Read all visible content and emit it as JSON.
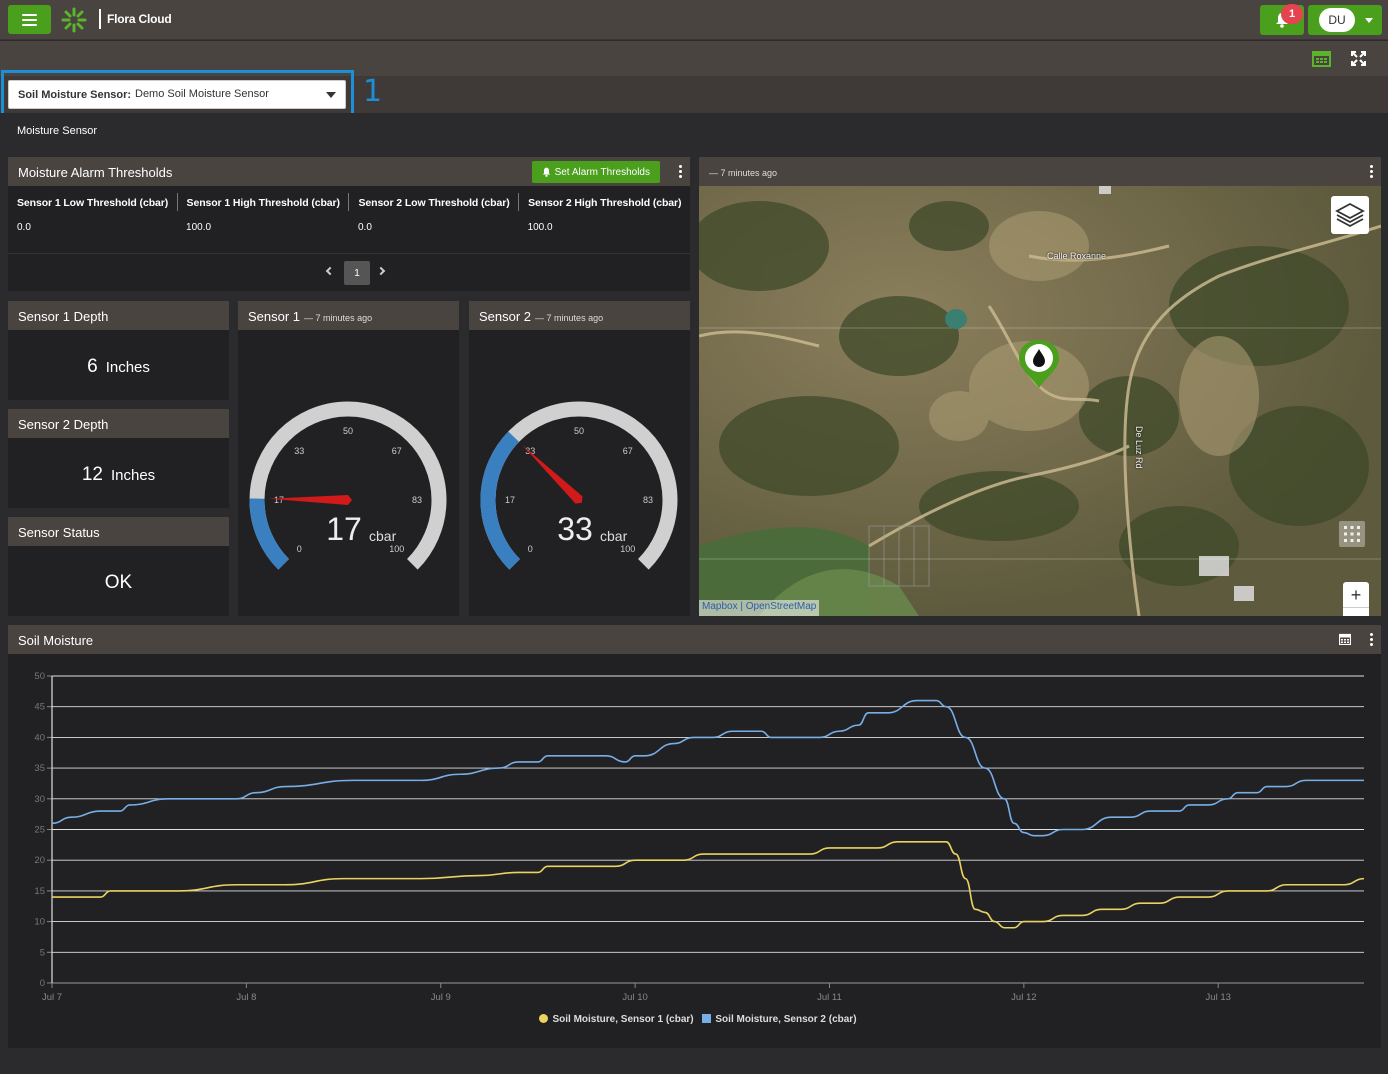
{
  "app": {
    "title": "Flora Cloud"
  },
  "header": {
    "notification_count": "1",
    "user_initials": "DU"
  },
  "selector": {
    "label": "Soil Moisture Sensor:",
    "value": "Demo Soil Moisture Sensor",
    "callout": "1"
  },
  "page": {
    "subtitle": "Moisture Sensor"
  },
  "alarm_panel": {
    "title": "Moisture Alarm Thresholds",
    "button_label": "Set Alarm Thresholds",
    "columns": [
      "Sensor 1 Low Threshold (cbar)",
      "Sensor 1 High Threshold (cbar)",
      "Sensor 2 Low Threshold (cbar)",
      "Sensor 2 High Threshold (cbar)"
    ],
    "rows": [
      [
        "0.0",
        "100.0",
        "0.0",
        "100.0"
      ]
    ],
    "page": "1"
  },
  "depth1": {
    "title": "Sensor 1 Depth",
    "value": "6",
    "unit": "Inches"
  },
  "depth2": {
    "title": "Sensor 2 Depth",
    "value": "12",
    "unit": "Inches"
  },
  "status": {
    "title": "Sensor Status",
    "value": "OK"
  },
  "gauge1": {
    "title": "Sensor 1",
    "time": "— 7 minutes ago",
    "value": 17,
    "display": "17",
    "unit": "cbar",
    "min": 0,
    "max": 100,
    "ticks": [
      "0",
      "17",
      "33",
      "50",
      "67",
      "83",
      "100"
    ]
  },
  "gauge2": {
    "title": "Sensor 2",
    "time": "— 7 minutes ago",
    "value": 33,
    "display": "33",
    "unit": "cbar",
    "min": 0,
    "max": 100,
    "ticks": [
      "0",
      "17",
      "33",
      "50",
      "67",
      "83",
      "100"
    ]
  },
  "map": {
    "time": "— 7 minutes ago",
    "label_road1": "Calle Roxanne",
    "label_road2": "De Luz Rd",
    "zoom_in": "+",
    "zoom_out": "−",
    "attribution_1": "Mapbox",
    "attribution_2": "OpenStreetMap",
    "marker_icon": "water-drop-icon"
  },
  "chart_panel": {
    "title": "Soil Moisture"
  },
  "chart_data": {
    "type": "line",
    "title": "Soil Moisture",
    "x_ticks": [
      "Jul 7",
      "Jul 8",
      "Jul 9",
      "Jul 10",
      "Jul 11",
      "Jul 12",
      "Jul 13"
    ],
    "ylim": [
      0,
      50
    ],
    "y_ticks": [
      0,
      5,
      10,
      15,
      20,
      25,
      30,
      35,
      40,
      45,
      50
    ],
    "grid": true,
    "legend": "bottom",
    "series": [
      {
        "name": "Soil Moisture, Sensor 1 (cbar)",
        "color": "#ead35f",
        "points": [
          [
            0,
            14
          ],
          [
            0.25,
            14
          ],
          [
            0.3,
            15
          ],
          [
            0.65,
            15
          ],
          [
            0.95,
            16
          ],
          [
            1.2,
            16
          ],
          [
            1.5,
            17
          ],
          [
            1.9,
            17
          ],
          [
            2.2,
            17.5
          ],
          [
            2.4,
            18
          ],
          [
            2.5,
            18
          ],
          [
            2.55,
            19
          ],
          [
            2.9,
            19
          ],
          [
            3.0,
            20
          ],
          [
            3.25,
            20
          ],
          [
            3.35,
            21
          ],
          [
            3.9,
            21
          ],
          [
            4.0,
            22
          ],
          [
            4.25,
            22
          ],
          [
            4.35,
            23
          ],
          [
            4.55,
            23
          ],
          [
            4.6,
            23
          ],
          [
            4.65,
            21
          ],
          [
            4.7,
            17
          ],
          [
            4.75,
            12
          ],
          [
            4.8,
            11.5
          ],
          [
            4.85,
            10
          ],
          [
            4.9,
            9
          ],
          [
            4.95,
            9
          ],
          [
            5.0,
            10
          ],
          [
            5.1,
            10
          ],
          [
            5.2,
            11
          ],
          [
            5.3,
            11
          ],
          [
            5.4,
            12
          ],
          [
            5.5,
            12
          ],
          [
            5.6,
            13
          ],
          [
            5.7,
            13
          ],
          [
            5.8,
            14
          ],
          [
            5.95,
            14
          ],
          [
            6.05,
            15
          ],
          [
            6.25,
            15
          ],
          [
            6.35,
            16
          ],
          [
            6.65,
            16
          ],
          [
            6.75,
            17
          ]
        ]
      },
      {
        "name": "Soil Moisture, Sensor 2 (cbar)",
        "color": "#78aee6",
        "points": [
          [
            0,
            26
          ],
          [
            0.1,
            27
          ],
          [
            0.25,
            28
          ],
          [
            0.35,
            28
          ],
          [
            0.4,
            29
          ],
          [
            0.6,
            30
          ],
          [
            0.95,
            30
          ],
          [
            1.05,
            31
          ],
          [
            1.2,
            32
          ],
          [
            1.55,
            33
          ],
          [
            1.9,
            33
          ],
          [
            2.1,
            34
          ],
          [
            2.3,
            35
          ],
          [
            2.4,
            36
          ],
          [
            2.5,
            36
          ],
          [
            2.55,
            37
          ],
          [
            2.85,
            37
          ],
          [
            2.95,
            36
          ],
          [
            3.0,
            37
          ],
          [
            3.05,
            37
          ],
          [
            3.2,
            39
          ],
          [
            3.3,
            40
          ],
          [
            3.4,
            40
          ],
          [
            3.5,
            41
          ],
          [
            3.65,
            41
          ],
          [
            3.7,
            40
          ],
          [
            3.95,
            40
          ],
          [
            4.05,
            41
          ],
          [
            4.15,
            42
          ],
          [
            4.2,
            44
          ],
          [
            4.3,
            44
          ],
          [
            4.45,
            46
          ],
          [
            4.55,
            46
          ],
          [
            4.6,
            45
          ],
          [
            4.7,
            40
          ],
          [
            4.8,
            35
          ],
          [
            4.9,
            30
          ],
          [
            4.95,
            26
          ],
          [
            5.0,
            24.5
          ],
          [
            5.05,
            24
          ],
          [
            5.1,
            24
          ],
          [
            5.2,
            25
          ],
          [
            5.3,
            25
          ],
          [
            5.45,
            27
          ],
          [
            5.55,
            27
          ],
          [
            5.65,
            28
          ],
          [
            5.8,
            28
          ],
          [
            5.85,
            29
          ],
          [
            5.95,
            29
          ],
          [
            6.05,
            30
          ],
          [
            6.1,
            31
          ],
          [
            6.2,
            31
          ],
          [
            6.25,
            32
          ],
          [
            6.35,
            32
          ],
          [
            6.45,
            33
          ],
          [
            6.75,
            33
          ]
        ]
      }
    ]
  }
}
